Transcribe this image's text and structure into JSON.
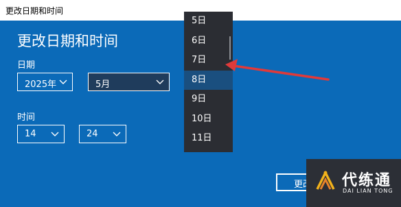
{
  "window": {
    "title": "更改日期和时间"
  },
  "main": {
    "heading": "更改日期和时间"
  },
  "date": {
    "label": "日期",
    "year_value": "2025年",
    "month_value": "5月"
  },
  "time": {
    "label": "时间",
    "hour_value": "14",
    "minute_value": "24"
  },
  "day_dropdown": {
    "items": [
      "5日",
      "6日",
      "7日",
      "8日",
      "9日",
      "10日",
      "11日"
    ],
    "selected": "8日"
  },
  "change_button": {
    "label": "更改"
  },
  "watermark": {
    "brand": "代练通",
    "subtitle": "DAI LIAN TONG"
  },
  "colors": {
    "background": "#0b6ab8",
    "dropdown": "#2b2d33",
    "dropdown_selected": "#1a4f7f",
    "annotation_arrow": "#e03a3a"
  },
  "icons": {
    "combo_chevron": "chevron-down-icon",
    "annotation": "red-arrow-icon",
    "watermark_logo": "daliantong-logo-icon"
  }
}
